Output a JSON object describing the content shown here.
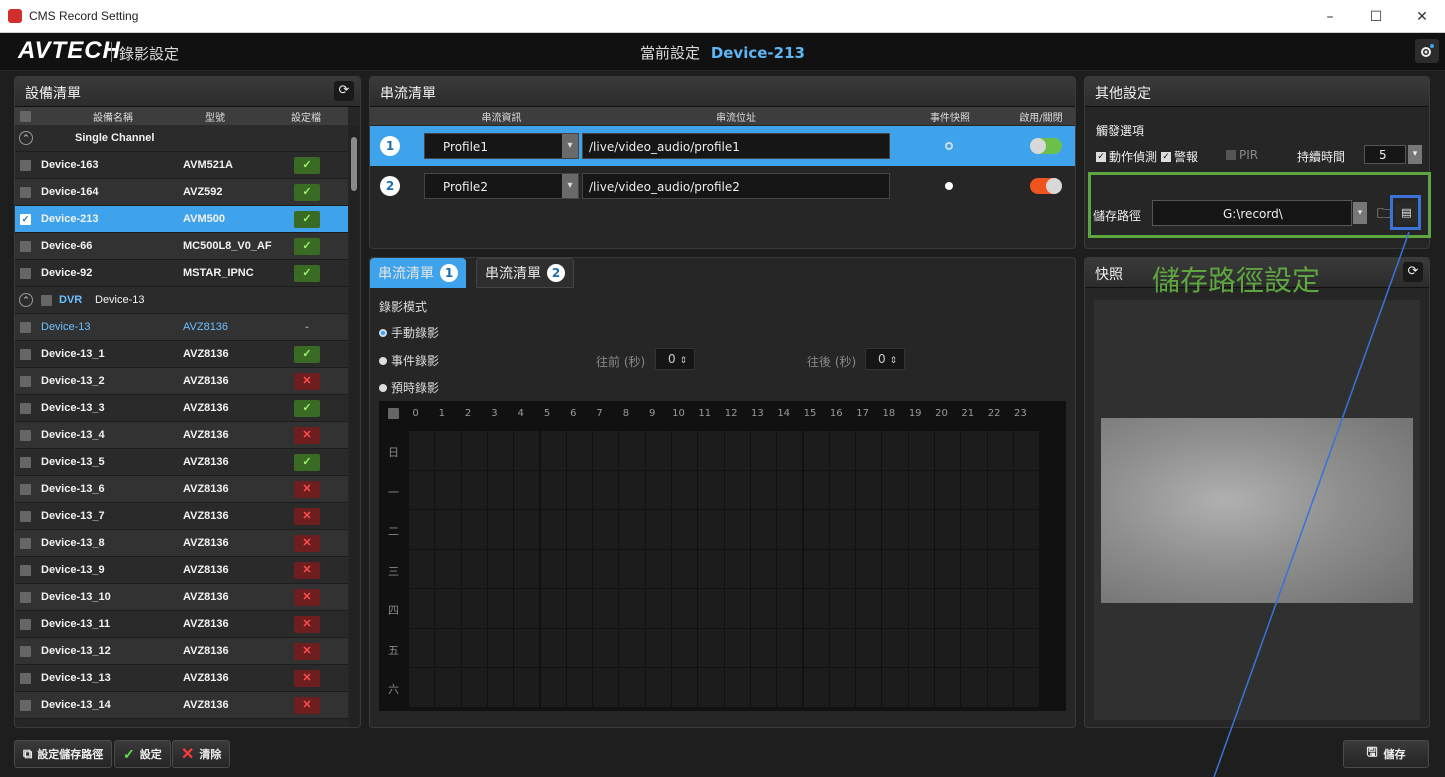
{
  "window": {
    "title": "CMS Record Setting",
    "minimize": "–",
    "maximize": "☐",
    "close": "✕"
  },
  "header": {
    "brand": "AVTECH",
    "subtitle": "錄影設定",
    "current_label": "當前設定",
    "current_device": "Device-213"
  },
  "device_list": {
    "title": "設備清單",
    "columns": [
      "設備名稱",
      "型號",
      "設定檔"
    ],
    "group1": "Single Channel",
    "rows_single": [
      {
        "name": "Device-163",
        "model": "AVM521A",
        "status": "ok"
      },
      {
        "name": "Device-164",
        "model": "AVZ592",
        "status": "ok"
      },
      {
        "name": "Device-213",
        "model": "AVM500",
        "status": "ok"
      },
      {
        "name": "Device-66",
        "model": "MC500L8_V0_AF",
        "status": "ok"
      },
      {
        "name": "Device-92",
        "model": "MSTAR_IPNC",
        "status": "ok"
      }
    ],
    "group2_tag": "DVR",
    "group2_name": "Device-13",
    "rows_dvr": [
      {
        "name": "Device-13",
        "model": "AVZ8136",
        "status": "none"
      },
      {
        "name": "Device-13_1",
        "model": "AVZ8136",
        "status": "ok"
      },
      {
        "name": "Device-13_2",
        "model": "AVZ8136",
        "status": "err"
      },
      {
        "name": "Device-13_3",
        "model": "AVZ8136",
        "status": "ok"
      },
      {
        "name": "Device-13_4",
        "model": "AVZ8136",
        "status": "err"
      },
      {
        "name": "Device-13_5",
        "model": "AVZ8136",
        "status": "ok"
      },
      {
        "name": "Device-13_6",
        "model": "AVZ8136",
        "status": "err"
      },
      {
        "name": "Device-13_7",
        "model": "AVZ8136",
        "status": "err"
      },
      {
        "name": "Device-13_8",
        "model": "AVZ8136",
        "status": "err"
      },
      {
        "name": "Device-13_9",
        "model": "AVZ8136",
        "status": "err"
      },
      {
        "name": "Device-13_10",
        "model": "AVZ8136",
        "status": "err"
      },
      {
        "name": "Device-13_11",
        "model": "AVZ8136",
        "status": "err"
      },
      {
        "name": "Device-13_12",
        "model": "AVZ8136",
        "status": "err"
      },
      {
        "name": "Device-13_13",
        "model": "AVZ8136",
        "status": "err"
      },
      {
        "name": "Device-13_14",
        "model": "AVZ8136",
        "status": "err"
      }
    ],
    "none_mark": "-",
    "ok_mark": "✓",
    "err_mark": "✕"
  },
  "toolbar": {
    "set_path": "設定儲存路徑",
    "set": "設定",
    "clear": "清除",
    "save": "儲存"
  },
  "stream_list": {
    "title": "串流清單",
    "columns": [
      "串流資訊",
      "串流位址",
      "事件快照",
      "啟用/關閉"
    ],
    "rows": [
      {
        "num": "1",
        "profile": "Profile1",
        "url": "/live/video_audio/profile1",
        "enabled": true
      },
      {
        "num": "2",
        "profile": "Profile2",
        "url": "/live/video_audio/profile2",
        "enabled": false
      }
    ]
  },
  "record": {
    "tab_label": "串流清單",
    "tab1_num": "1",
    "tab2_num": "2",
    "mode_title": "錄影模式",
    "manual": "手動錄影",
    "event": "事件錄影",
    "scheduled": "預時錄影",
    "pre_label": "往前 (秒)",
    "pre_value": "0",
    "post_label": "往後 (秒)",
    "post_value": "0",
    "hours": [
      "0",
      "1",
      "2",
      "3",
      "4",
      "5",
      "6",
      "7",
      "8",
      "9",
      "10",
      "11",
      "12",
      "13",
      "14",
      "15",
      "16",
      "17",
      "18",
      "19",
      "20",
      "21",
      "22",
      "23"
    ],
    "days": [
      "日",
      "一",
      "二",
      "三",
      "四",
      "五",
      "六"
    ]
  },
  "other": {
    "title": "其他設定",
    "trigger_title": "觸發選項",
    "motion": "動作偵測",
    "alarm": "警報",
    "pir": "PIR",
    "duration_label": "持續時間",
    "duration_value": "5",
    "path_label": "儲存路徑",
    "path_value": "G:\\record\\"
  },
  "snapshot": {
    "title": "快照",
    "annotation": "儲存路徑設定"
  },
  "colors": {
    "accent": "#3ea3ea",
    "ok": "#5ee04a",
    "err": "#ff3a3a",
    "highlight_green": "#5ea63f",
    "highlight_blue": "#3a72d8"
  }
}
